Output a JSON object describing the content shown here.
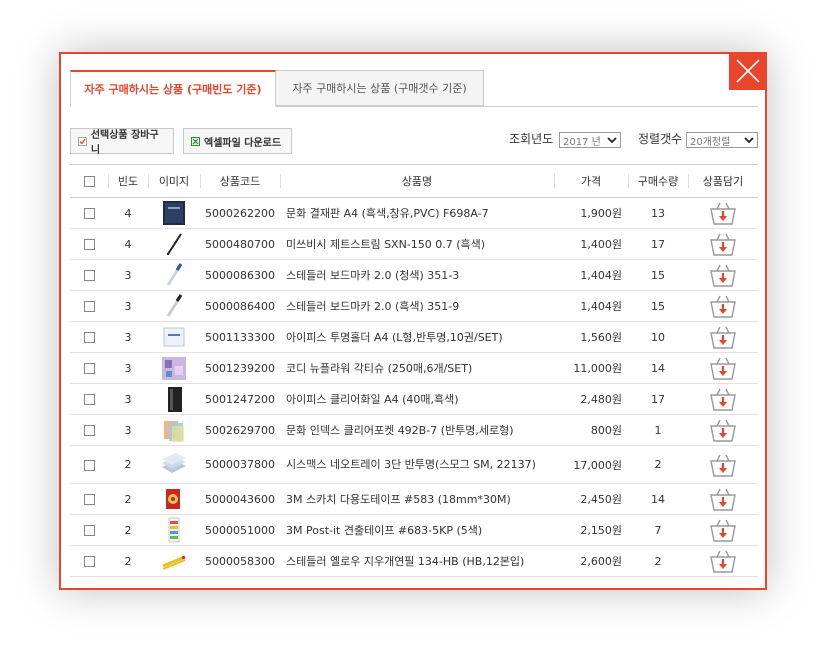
{
  "tabs": [
    {
      "label": "자주 구매하시는 상품 (구매빈도 기준)"
    },
    {
      "label": "자주 구매하시는 상품 (구매갯수 기준)"
    }
  ],
  "toolbar": {
    "add_cart_label": "선택상품 장바구니",
    "excel_label": "엑셀파일 다운로드",
    "year_label": "조회년도",
    "year_value": "2017 년",
    "sort_label": "정렬갯수",
    "sort_value": "20개정렬"
  },
  "table": {
    "headers": [
      "빈도",
      "이미지",
      "상품코드",
      "상품명",
      "가격",
      "구매수량",
      "상품담기"
    ],
    "rows": [
      {
        "freq": "4",
        "code": "5000262200",
        "name": "문화 결재판 A4 (흑색,창유,PVC) F698A-7",
        "price": "1,900원",
        "qty": "13",
        "img": "binder"
      },
      {
        "freq": "4",
        "code": "5000480700",
        "name": "미쓰비시 제트스트림 SXN-150 0.7 (흑색)",
        "price": "1,400원",
        "qty": "17",
        "img": "pen"
      },
      {
        "freq": "3",
        "code": "5000086300",
        "name": "스테들러 보드마카 2.0 (청색) 351-3",
        "price": "1,404원",
        "qty": "15",
        "img": "marker-blue"
      },
      {
        "freq": "3",
        "code": "5000086400",
        "name": "스테들러 보드마카 2.0 (흑색) 351-9",
        "price": "1,404원",
        "qty": "15",
        "img": "marker-black"
      },
      {
        "freq": "3",
        "code": "5001133300",
        "name": "아이피스 투명홀더 A4 (L형,반투명,10권/SET)",
        "price": "1,560원",
        "qty": "10",
        "img": "holder"
      },
      {
        "freq": "3",
        "code": "5001239200",
        "name": "코디 뉴플라워 각티슈 (250매,6개/SET)",
        "price": "11,000원",
        "qty": "14",
        "img": "tissue"
      },
      {
        "freq": "3",
        "code": "5001247200",
        "name": "아이피스 클리어화일 A4 (40매,흑색)",
        "price": "2,480원",
        "qty": "17",
        "img": "clearfile"
      },
      {
        "freq": "3",
        "code": "5002629700",
        "name": "문화 인덱스 클리어포켓 492B-7 (반투명,세로형)",
        "price": "800원",
        "qty": "1",
        "img": "pocket"
      },
      {
        "freq": "2",
        "code": "5000037800",
        "name": "시스맥스 네오트레이 3단 반투명(스모그 SM, 22137)",
        "price": "17,000원",
        "qty": "2",
        "img": "tray"
      },
      {
        "freq": "2",
        "code": "5000043600",
        "name": "3M 스카치 다용도테이프 #583 (18mm*30M)",
        "price": "2,450원",
        "qty": "14",
        "img": "tape"
      },
      {
        "freq": "2",
        "code": "5000051000",
        "name": "3M Post-it 견출테이프 #683-5KP (5색)",
        "price": "2,150원",
        "qty": "7",
        "img": "postit"
      },
      {
        "freq": "2",
        "code": "5000058300",
        "name": "스테들러 옐로우 지우개연필 134-HB (HB,12본입)",
        "price": "2,600원",
        "qty": "2",
        "img": "pencil"
      }
    ]
  },
  "colors": {
    "accent": "#e8452c",
    "cart_arrow": "#e8452c"
  },
  "icons": {
    "close": "close-icon",
    "cart": "cart-add-icon",
    "excel": "excel-icon",
    "check": "check-icon"
  }
}
